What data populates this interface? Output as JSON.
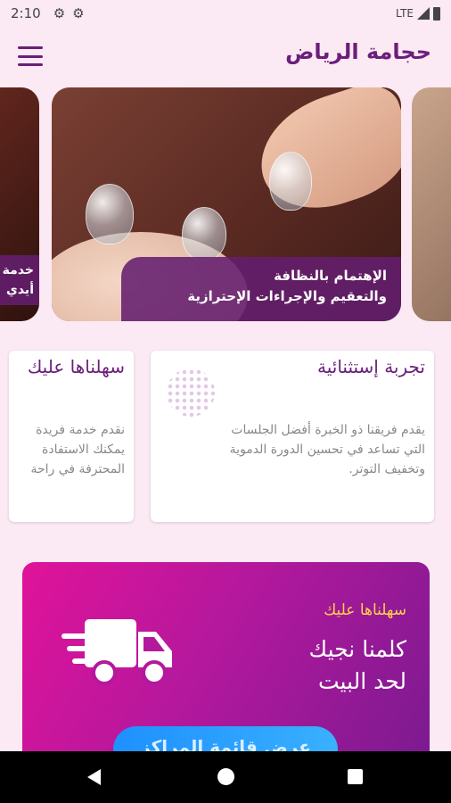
{
  "status_bar": {
    "time": "2:10",
    "network": "LTE"
  },
  "app_bar": {
    "title": "حجامة الرياض"
  },
  "carousel": {
    "slides": [
      {
        "caption": "خدمة\nأيدي"
      },
      {
        "caption": "الإهتمام بالنظافة\nوالتعقيم والإجراءات الإحترازية"
      }
    ]
  },
  "cards": [
    {
      "title": "تجربة إستثنائية",
      "body": "يقدم فريقنا ذو الخبرة أفضل الجلسات\nالتي تساعد في تحسين الدورة الدموية\nوتخفيف التوتر."
    },
    {
      "title": "سهلناها عليك",
      "body": "نقدم خدمة فريدة\nيمكنك الاستفادة\nالمحترفة في راحة"
    }
  ],
  "banner": {
    "subtitle": "سهلناها عليك",
    "title": "كلمنا نجيك\nلحد البيت",
    "button_label": "عرض قائمة المراكز"
  },
  "colors": {
    "brand": "#6b1e7a",
    "accent": "#e0139a",
    "highlight": "#ffd24a",
    "button": "#1e90ff"
  }
}
